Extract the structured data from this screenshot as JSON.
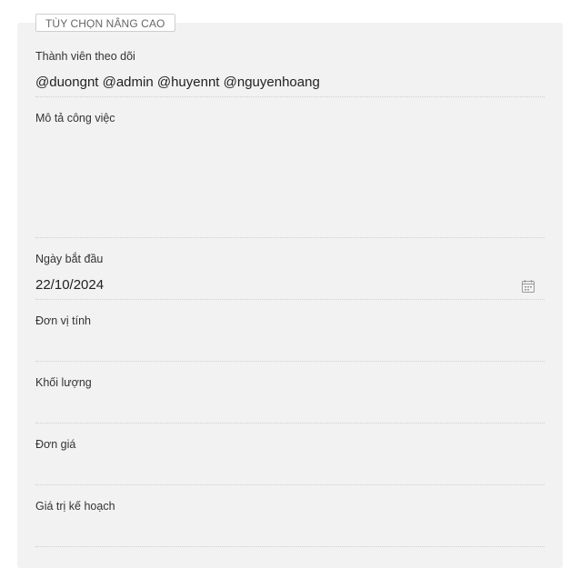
{
  "section": {
    "title": "TÙY CHỌN NÂNG CAO"
  },
  "fields": {
    "followers": {
      "label": "Thành viên theo dõi",
      "value": "@duongnt @admin @huyennt @nguyenhoang"
    },
    "description": {
      "label": "Mô tả công việc",
      "value": ""
    },
    "start_date": {
      "label": "Ngày bắt đầu",
      "value": "22/10/2024",
      "icon": "calendar-icon"
    },
    "unit": {
      "label": "Đơn vị tính",
      "value": ""
    },
    "quantity": {
      "label": "Khối lượng",
      "value": ""
    },
    "unit_price": {
      "label": "Đơn giá",
      "value": ""
    },
    "planned_value": {
      "label": "Giá trị kế hoạch",
      "value": ""
    }
  },
  "colors": {
    "panel_bg": "#f2f2f2",
    "divider": "#cfcfcf",
    "label_text": "#333333",
    "value_text": "#222222",
    "icon": "#9a9a9a"
  }
}
